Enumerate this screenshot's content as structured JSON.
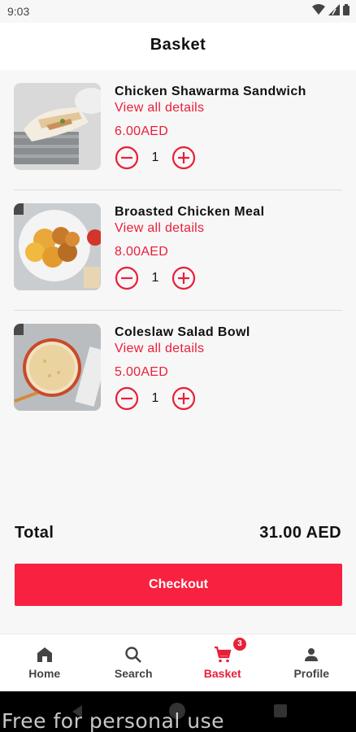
{
  "status": {
    "time": "9:03"
  },
  "header": {
    "title": "Basket"
  },
  "cart": {
    "items": [
      {
        "name": "Chicken Shawarma Sandwich",
        "details_label": "View all details",
        "price": "6.00AED",
        "quantity": "1",
        "image": "shawarma-wrap-photo"
      },
      {
        "name": "Broasted Chicken Meal",
        "details_label": "View all details",
        "price": "8.00AED",
        "quantity": "1",
        "image": "broasted-chicken-photo"
      },
      {
        "name": "Coleslaw Salad Bowl",
        "details_label": "View all details",
        "price": "5.00AED",
        "quantity": "1",
        "image": "coleslaw-bowl-photo"
      }
    ]
  },
  "summary": {
    "total_label": "Total",
    "total_value": "31.00 AED"
  },
  "checkout": {
    "label": "Checkout"
  },
  "nav": {
    "items": [
      {
        "label": "Home",
        "icon": "home-icon"
      },
      {
        "label": "Search",
        "icon": "search-icon"
      },
      {
        "label": "Basket",
        "icon": "cart-icon",
        "badge": "3",
        "active": true
      },
      {
        "label": "Profile",
        "icon": "person-icon"
      }
    ]
  },
  "watermark": "Free for personal use",
  "colors": {
    "accent": "#e91f3a",
    "button": "#f8213f",
    "background": "#f7f7f7"
  }
}
